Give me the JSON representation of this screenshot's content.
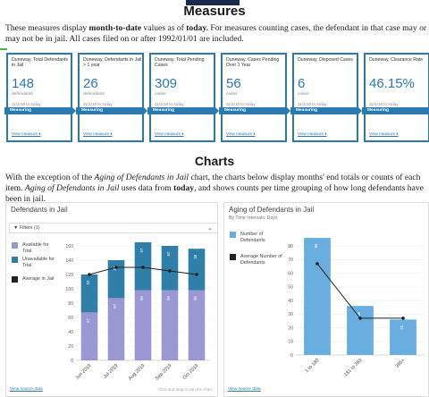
{
  "measures": {
    "title": "Measures",
    "intro_prefix": "These measures display ",
    "intro_bold1": "month-to-date",
    "intro_mid": " values as of ",
    "intro_bold2": "today.",
    "intro_suffix": " For measures counting cases, the defendant in that case may or may not be in jail. All cases filed on or after 1992/01/01 are included."
  },
  "cards": [
    {
      "title": "Duneway, Total Defendants in Jail",
      "value": "148",
      "unit": "defendants",
      "date": "11/1/19 to today",
      "ribbon": "Measuring",
      "link": "View measure ▾"
    },
    {
      "title": "Duneway, Defendants in Jail > 1 year",
      "value": "26",
      "unit": "defendants",
      "date": "11/1/19 to today",
      "ribbon": "Measuring",
      "link": "View measure ▾"
    },
    {
      "title": "Duneway, Total Pending Cases",
      "value": "309",
      "unit": "cases",
      "date": "11/1/19 to today",
      "ribbon": "Measuring",
      "link": "View measure ▾"
    },
    {
      "title": "Duneway, Cases Pending Over 1 Year",
      "value": "56",
      "unit": "cases",
      "date": "11/1/19 to today",
      "ribbon": "Measuring",
      "link": "View measure ▾"
    },
    {
      "title": "Duneway, Disposed Cases",
      "value": "6",
      "unit": "cases",
      "date": "11/1/19 to today",
      "ribbon": "Measuring",
      "link": "View measure ▾"
    },
    {
      "title": "Duneway, Clearance Rate",
      "value": "46.15%",
      "unit": "",
      "date": "11/1/19 to today",
      "ribbon": "Measuring",
      "link": "View measure ▾"
    }
  ],
  "charts_section": {
    "title": "Charts",
    "intro_a": "With the exception of the ",
    "intro_i1": "Aging of Defendants in Jail",
    "intro_b": " chart, the charts below display months' end totals or counts of each item. ",
    "intro_i2": "Aging of Defendants in Jail",
    "intro_c": " uses data from ",
    "intro_bold": "today",
    "intro_d": ", and shows counts per time grouping of how long defendants have been in jail."
  },
  "left_panel": {
    "title": "Defendants in Jail",
    "filters_label": "▼  Filters (1)",
    "chevron": "⌄",
    "link": "View source data",
    "hint": "Click and drag to pan the chart"
  },
  "right_panel": {
    "title": "Aging of Defendants in Jail",
    "subtitle": "By Time Intervals: Days",
    "link": "View source data"
  },
  "colors": {
    "available": "#9b97d3",
    "unavailable": "#2f7fa8",
    "average": "#222222",
    "aging_bar": "#6aaee0",
    "accent": "#2a7ab0"
  },
  "chart_data": [
    {
      "type": "bar",
      "stacked": true,
      "categories": [
        "Jun 2019",
        "Jul 2019",
        "Aug 2019",
        "Sep 2019",
        "Oct 2019"
      ],
      "series": [
        {
          "name": "Available for Trial",
          "values": [
            67,
            87,
            98,
            98,
            98
          ]
        },
        {
          "name": "Unavailable for Trial",
          "values": [
            53,
            53,
            67,
            62,
            58
          ]
        },
        {
          "name": "Average in Jail",
          "type": "line",
          "values": [
            120,
            130,
            130,
            125,
            120
          ]
        }
      ],
      "yticks": [
        0,
        20,
        40,
        60,
        80,
        100,
        120,
        140,
        160
      ],
      "ylim": [
        0,
        170
      ],
      "legend": "left"
    },
    {
      "type": "bar",
      "categories": [
        "1 to 180",
        "181 to 365",
        "365+"
      ],
      "series": [
        {
          "name": "Number of Defendants",
          "values": [
            86,
            36,
            26
          ]
        },
        {
          "name": "Average Number of Defendants",
          "type": "line",
          "values": [
            67,
            27,
            27
          ]
        }
      ],
      "yticks": [
        0,
        10,
        20,
        30,
        40,
        50,
        60,
        70,
        80
      ],
      "ylim": [
        0,
        88
      ],
      "legend": "left"
    }
  ]
}
